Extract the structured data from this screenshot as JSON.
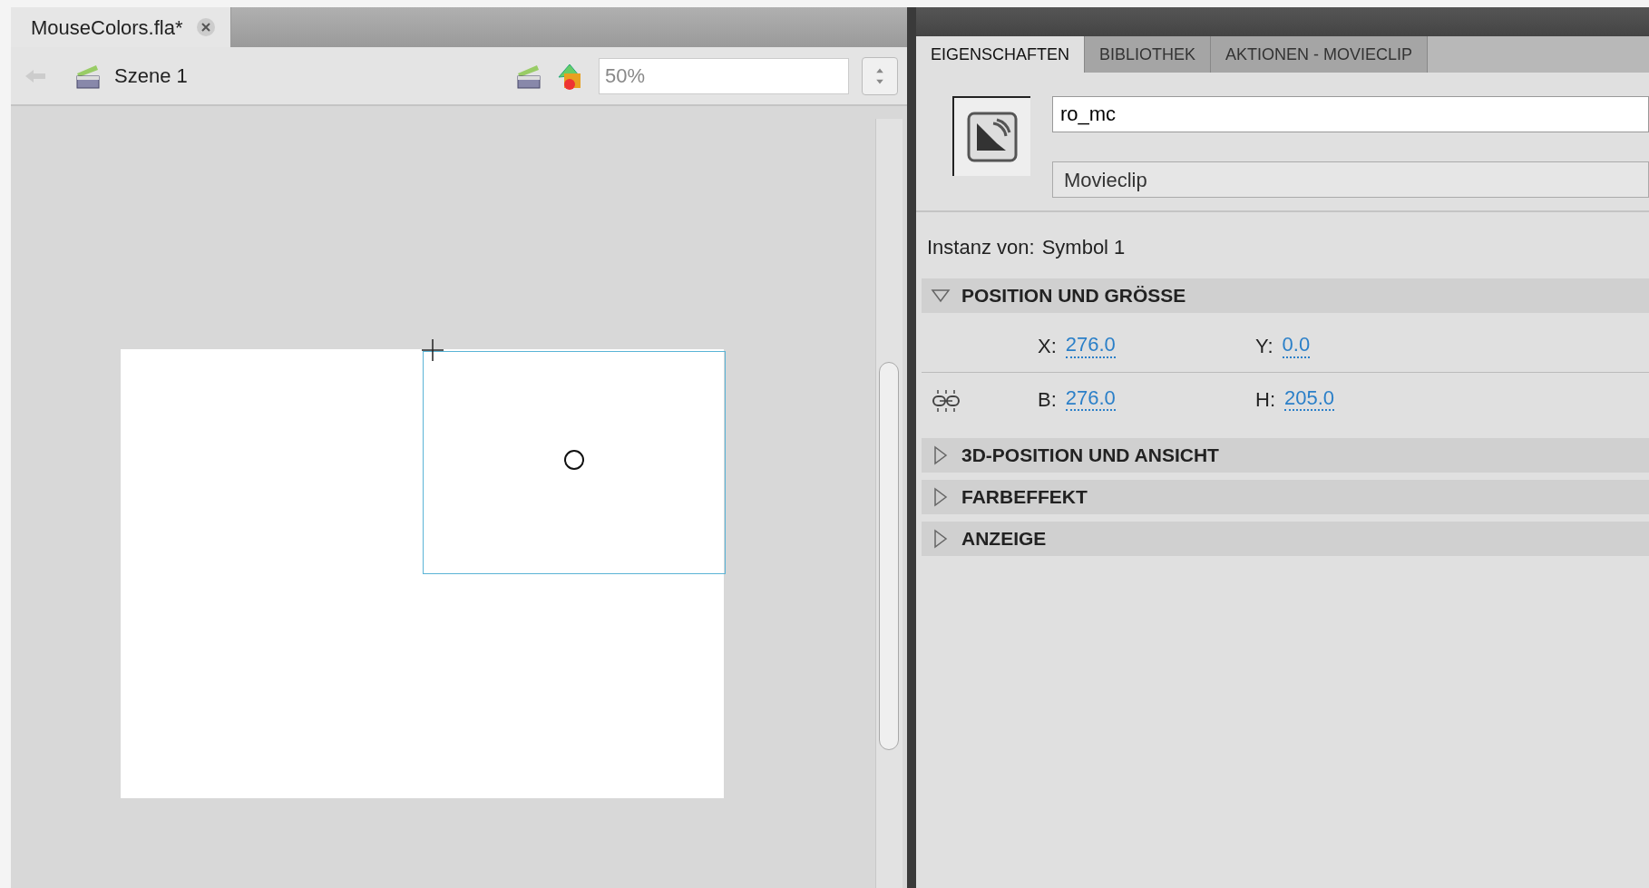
{
  "document_tab": {
    "title": "MouseColors.fla*"
  },
  "toolbar": {
    "scene": "Szene 1",
    "zoom": "50%"
  },
  "panel": {
    "tabs": [
      {
        "label": "EIGENSCHAFTEN",
        "selected": true
      },
      {
        "label": "BIBLIOTHEK",
        "selected": false
      },
      {
        "label": "AKTIONEN - MOVIECLIP",
        "selected": false
      }
    ],
    "instance_name": "ro_mc",
    "symbol_type": "Movieclip",
    "instance_of_label": "Instanz von:",
    "instance_of": "Symbol 1",
    "sections": [
      {
        "title": "POSITION UND GRÖSSE",
        "expanded": true,
        "rows": [
          [
            {
              "label": "X:",
              "value": "276.0"
            },
            {
              "label": "Y:",
              "value": "0.0"
            }
          ],
          [
            {
              "label": "B:",
              "value": "276.0"
            },
            {
              "label": "H:",
              "value": "205.0"
            }
          ]
        ]
      },
      {
        "title": "3D-POSITION UND ANSICHT",
        "expanded": false
      },
      {
        "title": "FARBEFFEKT",
        "expanded": false
      },
      {
        "title": "ANZEIGE",
        "expanded": false
      }
    ]
  }
}
